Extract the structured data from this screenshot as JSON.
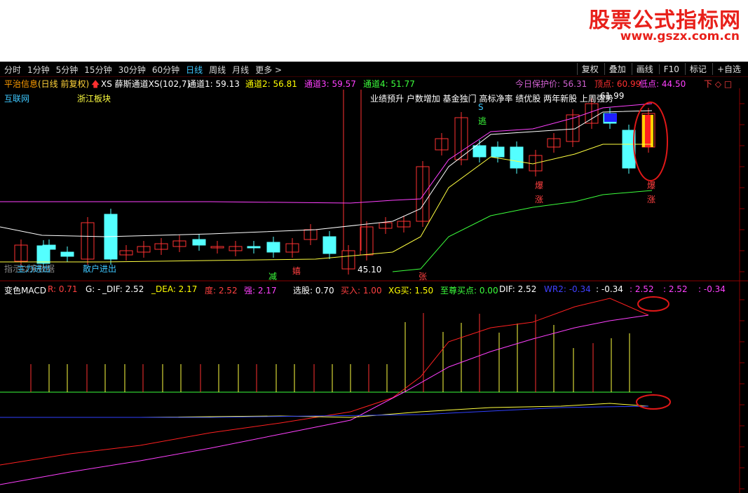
{
  "watermark": {
    "title": "股票公式指标网",
    "url": "www.gszx.com.cn"
  },
  "toolbar": {
    "periods": [
      "分时",
      "1分钟",
      "5分钟",
      "15分钟",
      "30分钟",
      "60分钟",
      "日线",
      "周线",
      "月线",
      "更多 >"
    ],
    "active_period": "日线",
    "buttons": [
      "复权",
      "叠加",
      "画线",
      "F10",
      "标记",
      "+自选"
    ]
  },
  "stock_info": {
    "name": "平治信息",
    "mode": "(日线 前复权)",
    "indicator": "XS 薛斯通道XS(102,7)",
    "channels": [
      "通道1: 59.13",
      "通道2: 56.81",
      "通道3: 59.57",
      "通道4: 51.77"
    ],
    "protect_price": "今日保护价: 56.31",
    "top_point": "顶点: 60.99",
    "low_point": "低点: 44.50",
    "nav": "下 ◇ □"
  },
  "main_chart": {
    "tags_left": [
      "互联网",
      "浙江板块"
    ],
    "tags_right": "业绩预升 户数增加 基金独门 高标净率 绩优股 两年新股 上周强势",
    "price_label": "61.99",
    "low_label": "45.10",
    "signals": {
      "jian": "减",
      "xi": "嬉",
      "zhang": "张",
      "bao": "爆",
      "zhang2": "涨",
      "tao": "逃",
      "s": "S",
      "retail": "散户进出",
      "main": "主力进出",
      "hint": "指示以来数据"
    }
  },
  "macd_info": {
    "name": "变色MACD",
    "items": [
      "R: 0.71",
      "G: -",
      "_DIF: 2.52",
      "_DEA: 2.17",
      "度: 2.52",
      "强: 2.17",
      "选股: 0.70",
      "买入: 1.00",
      "XG买: 1.50",
      "至尊买点: 0.00",
      "DIF: 2.52",
      "WR2: -0.34",
      ": -0.34",
      ": 2.52",
      ": 2.52",
      ": -0.34"
    ]
  },
  "colors": {
    "up": "#ff3232",
    "down": "#54ffff",
    "bg": "#000000",
    "accent": "#e8201a"
  }
}
